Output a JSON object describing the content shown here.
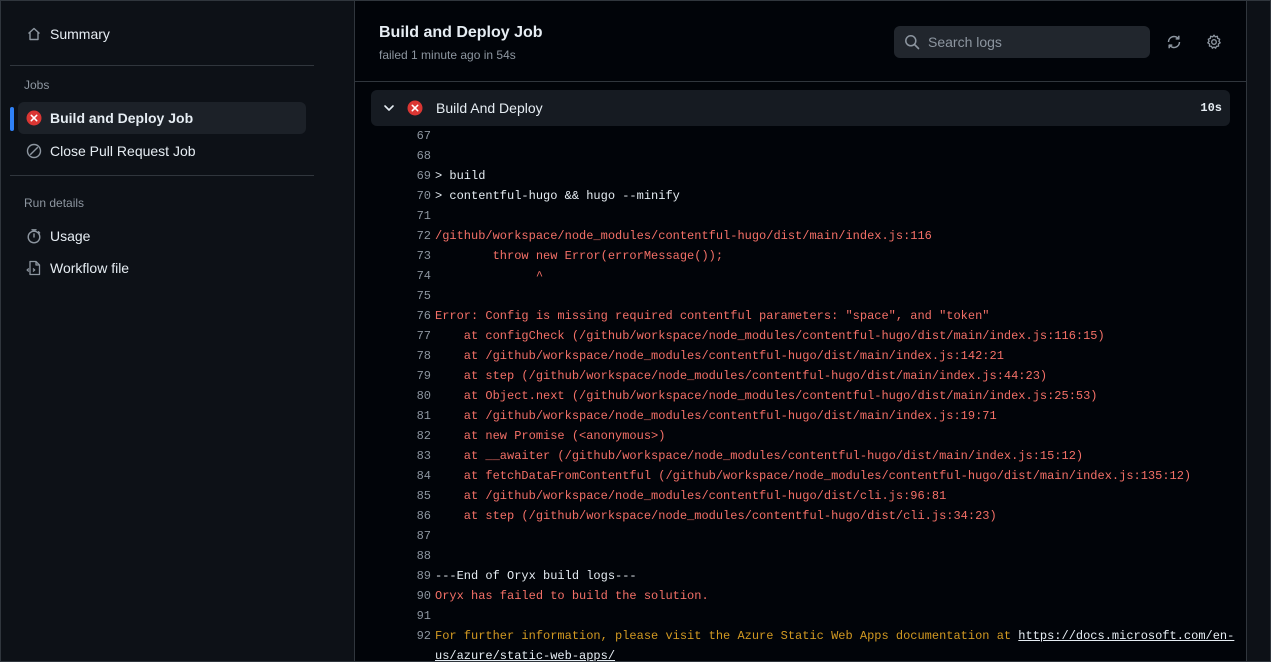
{
  "sidebar": {
    "summary_label": "Summary",
    "jobs_heading": "Jobs",
    "jobs": [
      {
        "label": "Build and Deploy Job"
      },
      {
        "label": "Close Pull Request Job"
      }
    ],
    "run_details_heading": "Run details",
    "details": [
      {
        "label": "Usage"
      },
      {
        "label": "Workflow file"
      }
    ]
  },
  "header": {
    "title": "Build and Deploy Job",
    "subtitle": "failed 1 minute ago in 54s",
    "search_placeholder": "Search logs"
  },
  "step": {
    "name": "Build And Deploy",
    "duration": "10s"
  },
  "log_lines": [
    {
      "num": "67",
      "text": "",
      "kind": "normal"
    },
    {
      "num": "68",
      "text": "",
      "kind": "normal"
    },
    {
      "num": "69",
      "text": "> build",
      "kind": "normal"
    },
    {
      "num": "70",
      "text": "> contentful-hugo && hugo --minify",
      "kind": "normal"
    },
    {
      "num": "71",
      "text": "",
      "kind": "normal"
    },
    {
      "num": "72",
      "text": "/github/workspace/node_modules/contentful-hugo/dist/main/index.js:116",
      "kind": "err"
    },
    {
      "num": "73",
      "text": "        throw new Error(errorMessage());",
      "kind": "err"
    },
    {
      "num": "74",
      "text": "              ^",
      "kind": "err"
    },
    {
      "num": "75",
      "text": "",
      "kind": "err"
    },
    {
      "num": "76",
      "text": "Error: Config is missing required contentful parameters: \"space\", and \"token\"",
      "kind": "err"
    },
    {
      "num": "77",
      "text": "    at configCheck (/github/workspace/node_modules/contentful-hugo/dist/main/index.js:116:15)",
      "kind": "err"
    },
    {
      "num": "78",
      "text": "    at /github/workspace/node_modules/contentful-hugo/dist/main/index.js:142:21",
      "kind": "err"
    },
    {
      "num": "79",
      "text": "    at step (/github/workspace/node_modules/contentful-hugo/dist/main/index.js:44:23)",
      "kind": "err"
    },
    {
      "num": "80",
      "text": "    at Object.next (/github/workspace/node_modules/contentful-hugo/dist/main/index.js:25:53)",
      "kind": "err"
    },
    {
      "num": "81",
      "text": "    at /github/workspace/node_modules/contentful-hugo/dist/main/index.js:19:71",
      "kind": "err"
    },
    {
      "num": "82",
      "text": "    at new Promise (<anonymous>)",
      "kind": "err"
    },
    {
      "num": "83",
      "text": "    at __awaiter (/github/workspace/node_modules/contentful-hugo/dist/main/index.js:15:12)",
      "kind": "err"
    },
    {
      "num": "84",
      "text": "    at fetchDataFromContentful (/github/workspace/node_modules/contentful-hugo/dist/main/index.js:135:12)",
      "kind": "err"
    },
    {
      "num": "85",
      "text": "    at /github/workspace/node_modules/contentful-hugo/dist/cli.js:96:81",
      "kind": "err"
    },
    {
      "num": "86",
      "text": "    at step (/github/workspace/node_modules/contentful-hugo/dist/cli.js:34:23)",
      "kind": "err"
    },
    {
      "num": "87",
      "text": "",
      "kind": "normal"
    },
    {
      "num": "88",
      "text": "",
      "kind": "normal"
    },
    {
      "num": "89",
      "text": "---End of Oryx build logs---",
      "kind": "normal"
    },
    {
      "num": "90",
      "text": "Oryx has failed to build the solution.",
      "kind": "err"
    },
    {
      "num": "91",
      "text": "",
      "kind": "normal"
    },
    {
      "num": "92",
      "text": "For further information, please visit the Azure Static Web Apps documentation at ",
      "kind": "warn",
      "link": "https://docs.microsoft.com/en-",
      "link_cont": "us/azure/static-web-apps/"
    }
  ],
  "colors": {
    "error": "#f47067",
    "warning": "#d29922",
    "accent": "#2f81f7"
  }
}
